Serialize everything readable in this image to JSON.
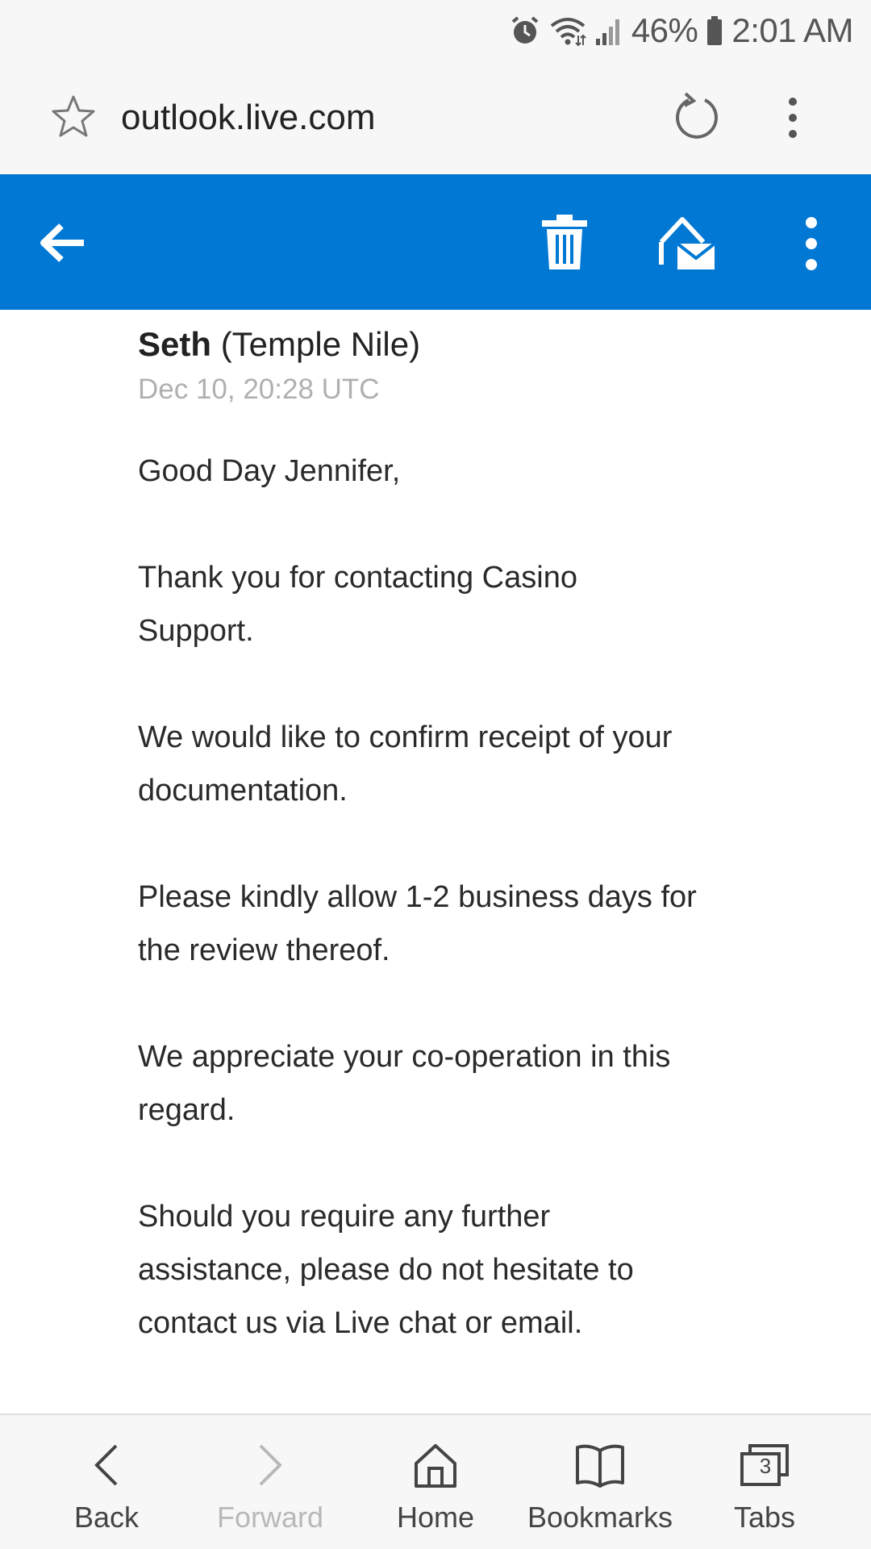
{
  "status_bar": {
    "battery_percent": "46%",
    "time": "2:01 AM",
    "icons": [
      "alarm-icon",
      "wifi-icon",
      "signal-icon",
      "battery-icon"
    ]
  },
  "browser": {
    "url": "outlook.live.com"
  },
  "app_bar": {
    "accent_color": "#0078d4",
    "icons": [
      "back-arrow-icon",
      "trash-icon",
      "mark-read-icon",
      "more-vertical-icon"
    ]
  },
  "email": {
    "sender_name": "Seth",
    "sender_org": "(Temple Nile)",
    "date": "Dec 10, 20:28 UTC",
    "paragraphs": [
      "Good Day Jennifer,",
      "Thank you for contacting Casino Support.",
      "We would like to confirm receipt of your documentation.",
      "Please kindly allow 1-2 business days for the review thereof.",
      "We appreciate your co-operation in this regard.",
      "Should you require any further assistance, please do not hesitate to contact us via Live chat or email."
    ]
  },
  "bottom_nav": {
    "items": [
      {
        "label": "Back",
        "icon": "chevron-left-icon",
        "enabled": true
      },
      {
        "label": "Forward",
        "icon": "chevron-right-icon",
        "enabled": false
      },
      {
        "label": "Home",
        "icon": "home-icon",
        "enabled": true
      },
      {
        "label": "Bookmarks",
        "icon": "bookmarks-icon",
        "enabled": true
      },
      {
        "label": "Tabs",
        "icon": "tabs-icon",
        "enabled": true,
        "count": "3"
      }
    ]
  }
}
